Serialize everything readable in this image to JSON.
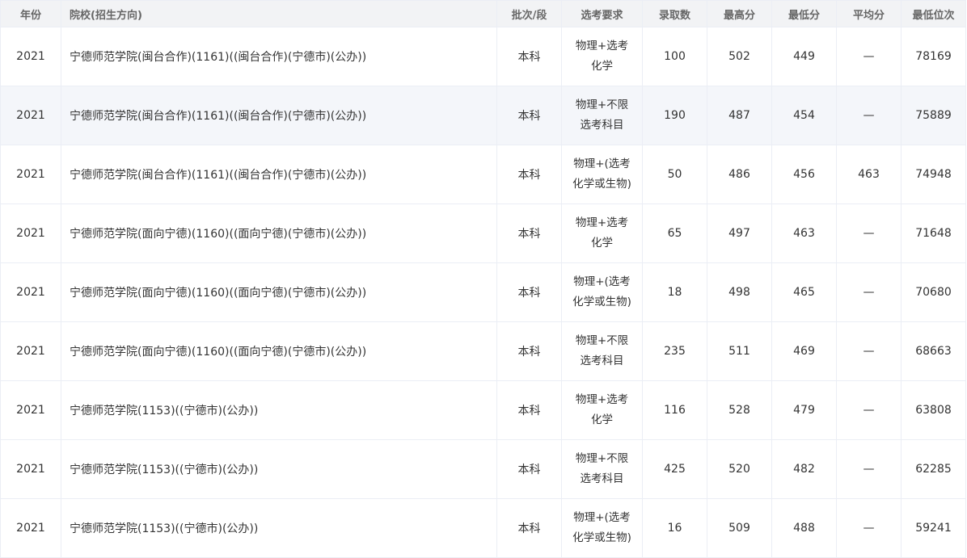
{
  "header": {
    "year": "年份",
    "school": "院校(招生方向)",
    "batch": "批次/段",
    "subject_req": "选考要求",
    "admitted": "录取数",
    "max_score": "最高分",
    "min_score": "最低分",
    "avg_score": "平均分",
    "min_rank": "最低位次"
  },
  "rows": [
    {
      "year": "2021",
      "school": "宁德师范学院(闽台合作)(1161)((闽台合作)(宁德市)(公办))",
      "batch": "本科",
      "req1": "物理+选考",
      "req2": "化学",
      "admitted": "100",
      "max": "502",
      "min": "449",
      "avg": "—",
      "rank": "78169"
    },
    {
      "year": "2021",
      "school": "宁德师范学院(闽台合作)(1161)((闽台合作)(宁德市)(公办))",
      "batch": "本科",
      "req1": "物理+不限",
      "req2": "选考科目",
      "admitted": "190",
      "max": "487",
      "min": "454",
      "avg": "—",
      "rank": "75889"
    },
    {
      "year": "2021",
      "school": "宁德师范学院(闽台合作)(1161)((闽台合作)(宁德市)(公办))",
      "batch": "本科",
      "req1": "物理+(选考",
      "req2": "化学或生物)",
      "admitted": "50",
      "max": "486",
      "min": "456",
      "avg": "463",
      "rank": "74948"
    },
    {
      "year": "2021",
      "school": "宁德师范学院(面向宁德)(1160)((面向宁德)(宁德市)(公办))",
      "batch": "本科",
      "req1": "物理+选考",
      "req2": "化学",
      "admitted": "65",
      "max": "497",
      "min": "463",
      "avg": "—",
      "rank": "71648"
    },
    {
      "year": "2021",
      "school": "宁德师范学院(面向宁德)(1160)((面向宁德)(宁德市)(公办))",
      "batch": "本科",
      "req1": "物理+(选考",
      "req2": "化学或生物)",
      "admitted": "18",
      "max": "498",
      "min": "465",
      "avg": "—",
      "rank": "70680"
    },
    {
      "year": "2021",
      "school": "宁德师范学院(面向宁德)(1160)((面向宁德)(宁德市)(公办))",
      "batch": "本科",
      "req1": "物理+不限",
      "req2": "选考科目",
      "admitted": "235",
      "max": "511",
      "min": "469",
      "avg": "—",
      "rank": "68663"
    },
    {
      "year": "2021",
      "school": "宁德师范学院(1153)((宁德市)(公办))",
      "batch": "本科",
      "req1": "物理+选考",
      "req2": "化学",
      "admitted": "116",
      "max": "528",
      "min": "479",
      "avg": "—",
      "rank": "63808"
    },
    {
      "year": "2021",
      "school": "宁德师范学院(1153)((宁德市)(公办))",
      "batch": "本科",
      "req1": "物理+不限",
      "req2": "选考科目",
      "admitted": "425",
      "max": "520",
      "min": "482",
      "avg": "—",
      "rank": "62285"
    },
    {
      "year": "2021",
      "school": "宁德师范学院(1153)((宁德市)(公办))",
      "batch": "本科",
      "req1": "物理+(选考",
      "req2": "化学或生物)",
      "admitted": "16",
      "max": "509",
      "min": "488",
      "avg": "—",
      "rank": "59241"
    }
  ]
}
